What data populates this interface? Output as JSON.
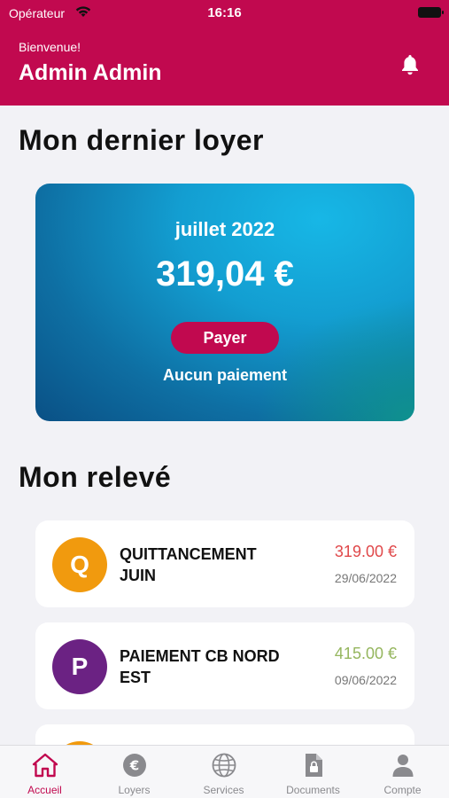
{
  "status_bar": {
    "carrier": "Opérateur",
    "time": "16:16"
  },
  "header": {
    "welcome": "Bienvenue!",
    "user_name": "Admin Admin"
  },
  "last_rent": {
    "section_title": "Mon dernier loyer",
    "month": "juillet 2022",
    "amount": "319,04 €",
    "pay_label": "Payer",
    "status": "Aucun paiement"
  },
  "statement": {
    "section_title": "Mon relevé",
    "items": [
      {
        "initial": "Q",
        "label": "QUITTANCEMENT JUIN",
        "amount": "319.00 €",
        "date": "29/06/2022",
        "avatar_color": "#f19a0e",
        "amount_color": "#e0484a"
      },
      {
        "initial": "P",
        "label": "PAIEMENT CB NORD EST",
        "amount": "415.00 €",
        "date": "09/06/2022",
        "avatar_color": "#6b2283",
        "amount_color": "#95b65e"
      }
    ],
    "partial_avatar_color": "#f19a0e"
  },
  "tabbar": {
    "items": [
      {
        "label": "Accueil",
        "icon": "home-icon",
        "active": true
      },
      {
        "label": "Loyers",
        "icon": "euro-icon",
        "active": false
      },
      {
        "label": "Services",
        "icon": "globe-icon",
        "active": false
      },
      {
        "label": "Documents",
        "icon": "document-lock-icon",
        "active": false
      },
      {
        "label": "Compte",
        "icon": "person-icon",
        "active": false
      }
    ]
  },
  "colors": {
    "brand": "#c1094f",
    "background": "#f2f2f6"
  }
}
